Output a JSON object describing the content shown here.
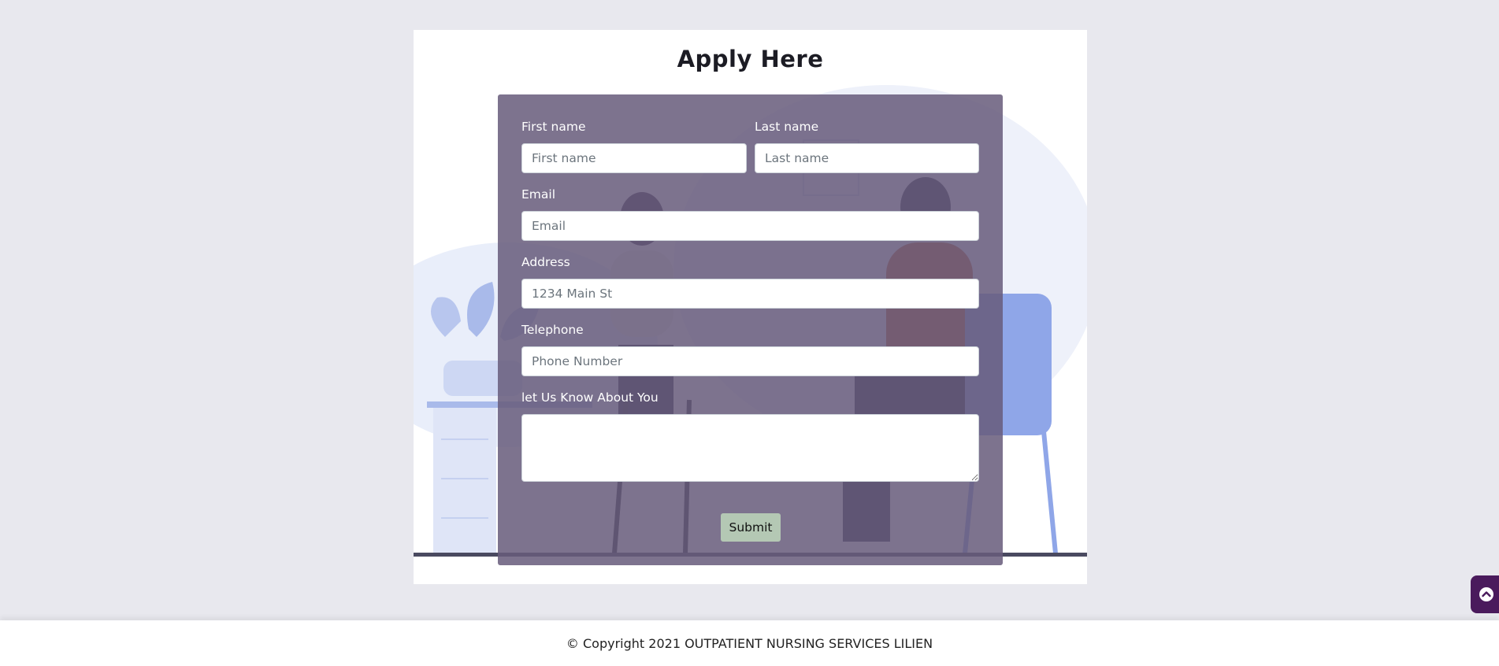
{
  "form": {
    "title": "Apply Here",
    "first_name": {
      "label": "First name",
      "placeholder": "First name"
    },
    "last_name": {
      "label": "Last name",
      "placeholder": "Last name"
    },
    "email": {
      "label": "Email",
      "placeholder": "Email"
    },
    "address": {
      "label": "Address",
      "placeholder": "1234 Main St"
    },
    "telephone": {
      "label": "Telephone",
      "placeholder": "Phone Number"
    },
    "about": {
      "label": "let Us Know About You",
      "value": ""
    },
    "submit_label": "Submit"
  },
  "footer": {
    "copyright": "© Copyright 2021 OUTPATIENT NURSING SERVICES LILIEN"
  },
  "scroll_top": {
    "icon": "chevron-up-circle-icon"
  },
  "colors": {
    "panel": "#685c7c",
    "submit": "#b4c8b4",
    "scroll_top": "#4a1a5c",
    "illustration_blue": "#8fa6e8"
  }
}
